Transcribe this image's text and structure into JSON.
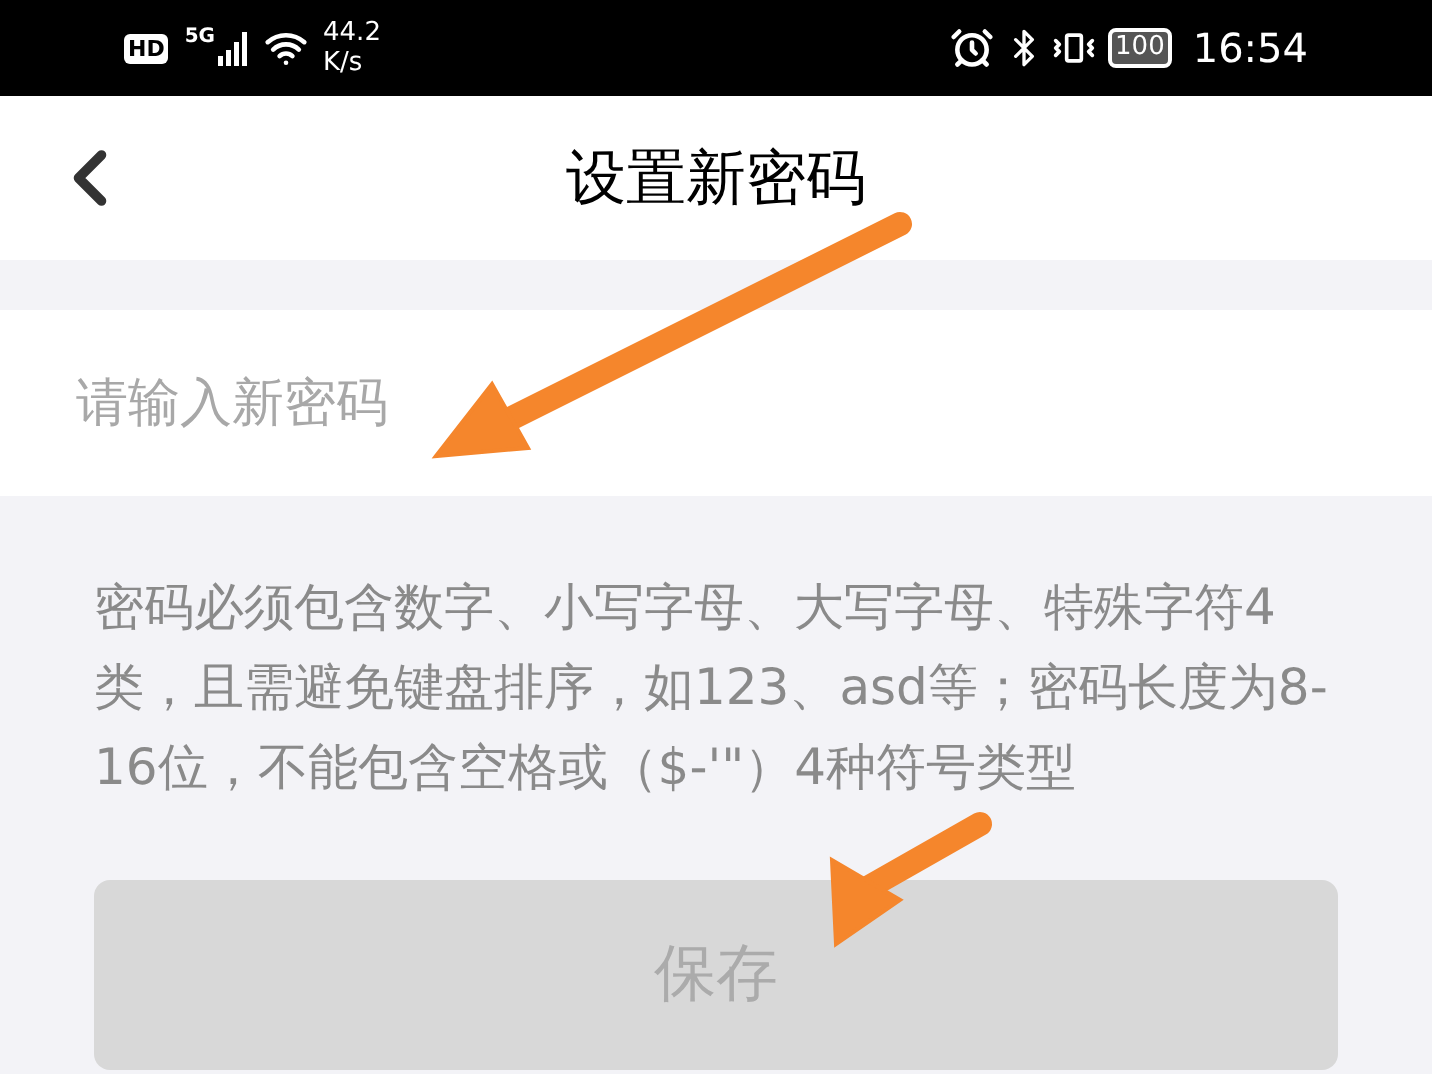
{
  "status_bar": {
    "hd": "HD",
    "network": "5G",
    "speed_value": "44.2",
    "speed_unit": "K/s",
    "battery": "100",
    "time": "16:54"
  },
  "header": {
    "title": "设置新密码"
  },
  "password_field": {
    "placeholder": "请输入新密码"
  },
  "hint": "密码必须包含数字、小写字母、大写字母、特殊字符4类，且需避免键盘排序，如123、asd等；密码长度为8-16位，不能包含空格或（$-'\"）4种符号类型",
  "save_button": {
    "label": "保存",
    "disabled": true
  }
}
